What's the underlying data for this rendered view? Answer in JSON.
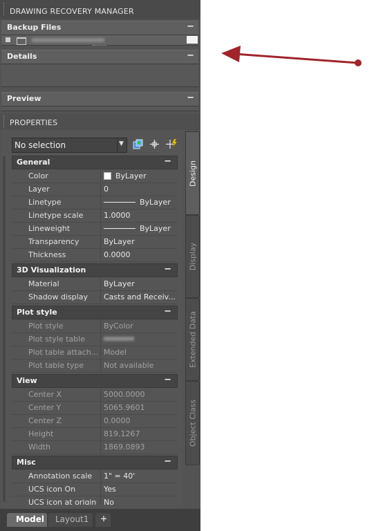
{
  "recovery": {
    "title": "DRAWING RECOVERY MANAGER",
    "backup_files": {
      "label": "Backup Files",
      "collapse": "−"
    },
    "details": {
      "label": "Details",
      "collapse": "−"
    },
    "preview": {
      "label": "Preview",
      "collapse": "−"
    }
  },
  "properties": {
    "title": "PROPERTIES",
    "selection": "No selection",
    "groups": {
      "general": {
        "label": "General",
        "collapse": "−",
        "rows": [
          {
            "label": "Color",
            "value": "ByLayer"
          },
          {
            "label": "Layer",
            "value": "0"
          },
          {
            "label": "Linetype",
            "value": "ByLayer"
          },
          {
            "label": "Linetype scale",
            "value": "1.0000"
          },
          {
            "label": "Lineweight",
            "value": "ByLayer"
          },
          {
            "label": "Transparency",
            "value": "ByLayer"
          },
          {
            "label": "Thickness",
            "value": "0.0000"
          }
        ]
      },
      "viz": {
        "label": "3D Visualization",
        "collapse": "−",
        "rows": [
          {
            "label": "Material",
            "value": "ByLayer"
          },
          {
            "label": "Shadow display",
            "value": "Casts and Receiv..."
          }
        ]
      },
      "plot": {
        "label": "Plot style",
        "collapse": "−",
        "rows": [
          {
            "label": "Plot style",
            "value": "ByColor"
          },
          {
            "label": "Plot style table",
            "value": ""
          },
          {
            "label": "Plot table attach...",
            "value": "Model"
          },
          {
            "label": "Plot table type",
            "value": "Not available"
          }
        ]
      },
      "view": {
        "label": "View",
        "collapse": "−",
        "rows": [
          {
            "label": "Center X",
            "value": "5000.0000"
          },
          {
            "label": "Center Y",
            "value": "5065.9601"
          },
          {
            "label": "Center Z",
            "value": "0.0000"
          },
          {
            "label": "Height",
            "value": "819.1267"
          },
          {
            "label": "Width",
            "value": "1869.0893"
          }
        ]
      },
      "misc": {
        "label": "Misc",
        "collapse": "−",
        "rows": [
          {
            "label": "Annotation scale",
            "value": "1\" = 40'"
          },
          {
            "label": "UCS icon On",
            "value": "Yes"
          },
          {
            "label": "UCS icon at origin",
            "value": "No"
          }
        ]
      }
    },
    "side_tabs": [
      "Design",
      "Display",
      "Extended Data",
      "Object Class"
    ]
  },
  "layout_tabs": {
    "model": "Model",
    "layout1": "Layout1",
    "add": "+"
  },
  "colors": {
    "arrow": "#a0252b",
    "panel": "#535353"
  }
}
